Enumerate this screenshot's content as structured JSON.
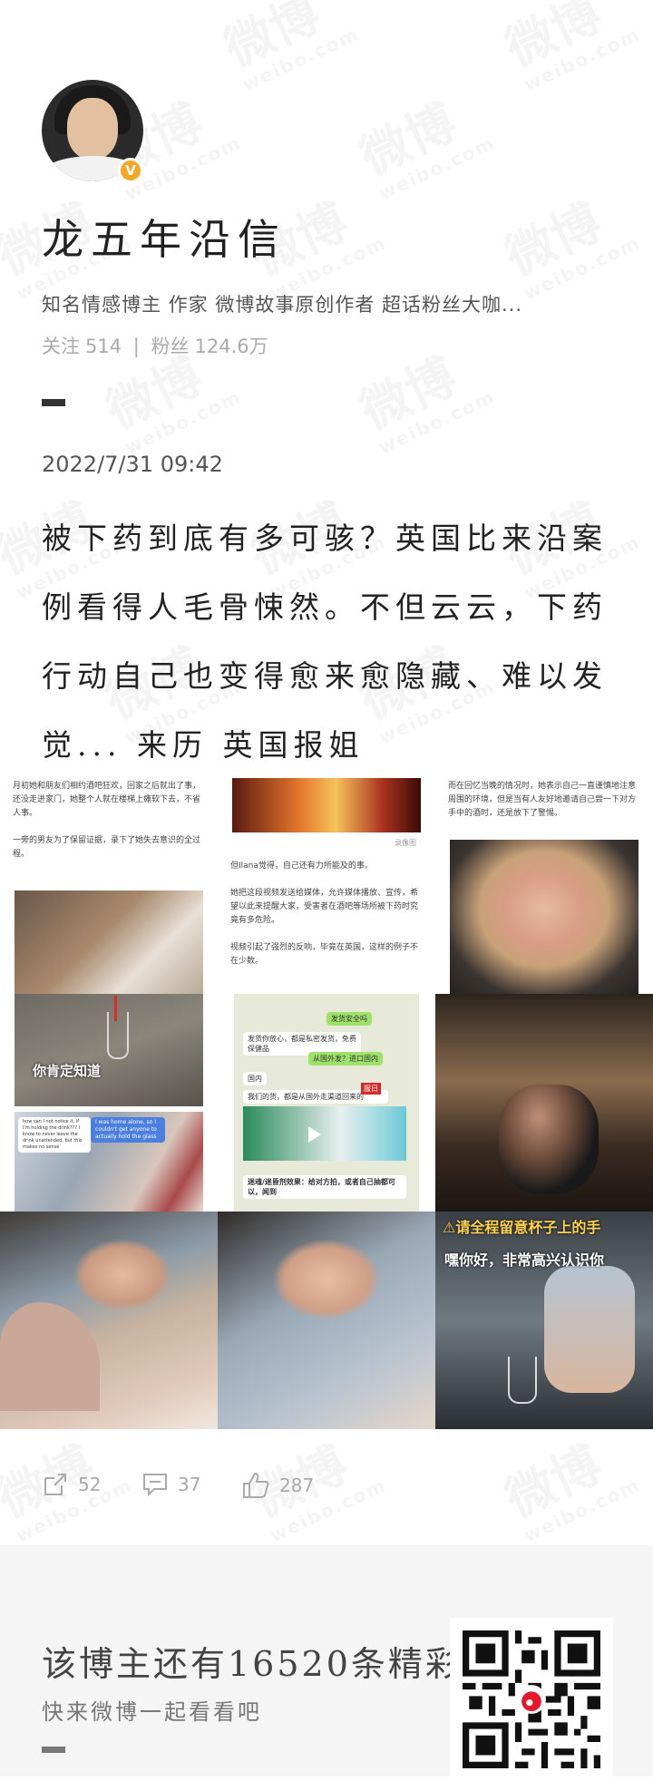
{
  "profile": {
    "name": "龙五年沿信",
    "verified_badge": "V",
    "description": "知名情感博主 作家 微博故事原创作者 超话粉丝大咖...",
    "follow_label": "关注",
    "follow_count": "514",
    "fans_label": "粉丝",
    "fans_count": "124.6万"
  },
  "post": {
    "date": "2022/7/31 09:42",
    "text": "被下药到底有多可骇？英国比来沿案例看得人毛骨悚然。不但云云，下药行动自己也变得愈来愈隐藏、难以发觉... 来历 英国报姐"
  },
  "images": {
    "tile1_text": "月初她和朋友们相约酒吧狂欢，回家之后就出了事，还没走进家门，她整个人就在楼梯上瘫软下去，不省人事。\n\n一旁的男友为了保留证据，录下了她失去意识的全过程。",
    "tile2_text": "但Ilana觉得，自己还有力所能及的事。\n\n她把这段视频发送给媒体，允许媒体播放、宣传，希望以此来提醒大家，受害者在酒吧等场所被下药时究竟有多危险。\n\n视频引起了强烈的反响，毕竟在英国，这样的例子不在少数。",
    "tile2_caption": "录像图",
    "tile3_text": "而在回忆当晚的情况时，她表示自己一直谨慎地注意周围的环境，但是当有人友好地邀请自己尝一下对方手中的酒时，还是放下了警惕。",
    "tile4_caption": "你肯定知道",
    "tile5_chat": [
      "发货安全吗",
      "发货你放心，都是私密发货，免费保健品",
      "从国外发？进口国内",
      "国内",
      "我们的货，都是从国外走渠道回来的"
    ],
    "tile5_caption": "迷魂/迷昏剂效果：给对方拍，或者自己抽都可以，闻到",
    "tile5_tag": "服日",
    "tile6_caption": "I was home alone, so I couldn't get anyone to actually hold the glass",
    "tile6_left": "how can I not notice it, if I'm holding the drink??? I know to never leave the drink unattended, but this makes no sense",
    "tile9_warning": "请全程留意杯子上的手",
    "tile9_subtitle": "嘿你好，非常高兴认识你"
  },
  "actions": {
    "repost": "52",
    "comment": "37",
    "like": "287"
  },
  "footer": {
    "promo_title": "该博主还有16520条精彩微博",
    "promo_sub": "快来微博一起看看吧"
  },
  "watermark": {
    "main": "微博",
    "sub": "weibo.com"
  },
  "colors": {
    "verified": "#f6a623",
    "text": "#222222",
    "muted": "#aaaaaa",
    "footer_bg": "#f5f5f5"
  }
}
